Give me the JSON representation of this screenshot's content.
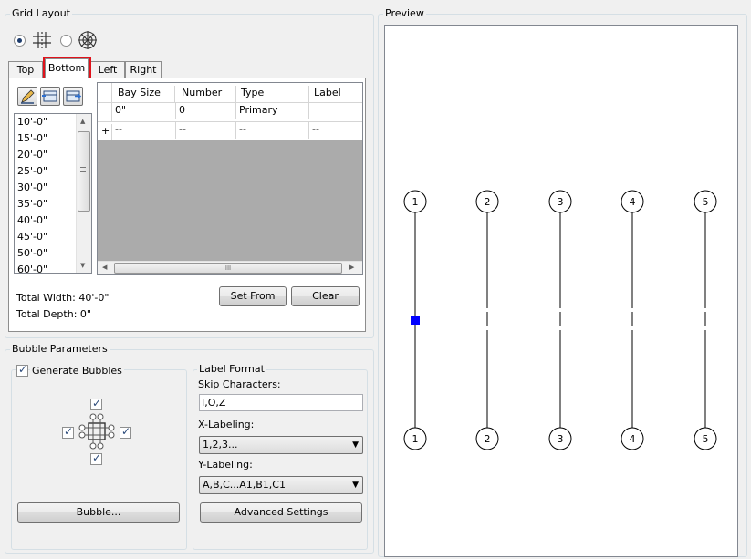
{
  "grid_layout": {
    "title": "Grid Layout",
    "tabs": [
      "Top",
      "Bottom",
      "Left",
      "Right"
    ],
    "active_tab": "Bottom",
    "size_list": [
      "10'-0\"",
      "15'-0\"",
      "20'-0\"",
      "25'-0\"",
      "30'-0\"",
      "35'-0\"",
      "40'-0\"",
      "45'-0\"",
      "50'-0\"",
      "60'-0\""
    ],
    "table": {
      "columns": [
        "Bay Size",
        "Number",
        "Type",
        "Label"
      ],
      "rows": [
        [
          "0\"",
          "0",
          "Primary",
          ""
        ],
        [
          "--",
          "--",
          "--",
          "--"
        ]
      ],
      "new_row_marker": "+",
      "hscroll_thumb": "III"
    },
    "total_width": "Total Width: 40'-0\"",
    "total_depth": "Total Depth: 0\"",
    "set_from_label": "Set From",
    "clear_label": "Clear"
  },
  "bubble_parameters": {
    "title": "Bubble Parameters",
    "generate_bubbles_label": "Generate Bubbles",
    "bubble_button_label": "Bubble...",
    "label_format": {
      "title": "Label Format",
      "skip_characters_label": "Skip Characters:",
      "skip_characters_value": "I,O,Z",
      "x_labeling_label": "X-Labeling:",
      "x_labeling_value": "1,2,3...",
      "y_labeling_label": "Y-Labeling:",
      "y_labeling_value": "A,B,C...A1,B1,C1",
      "advanced_settings_label": "Advanced Settings"
    }
  },
  "preview": {
    "title": "Preview",
    "grid_labels": [
      "1",
      "2",
      "3",
      "4",
      "5"
    ],
    "accent_color": "#0000ff"
  },
  "colors": {
    "highlight_box": "#e0121b",
    "selected_marker": "#0000ff"
  }
}
